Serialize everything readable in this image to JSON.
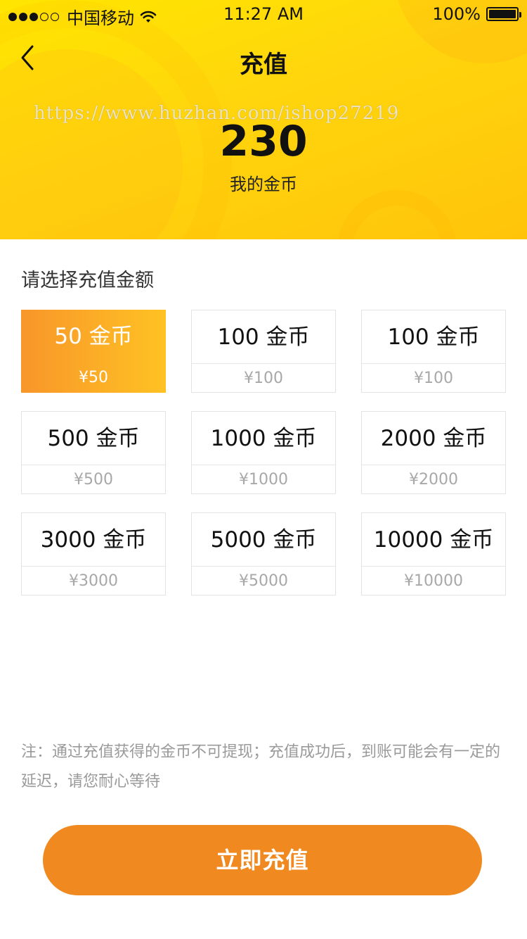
{
  "status_bar": {
    "carrier": "中国移动",
    "time": "11:27 AM",
    "battery": "100%",
    "signal_bars": 3,
    "signal_total": 5
  },
  "nav": {
    "title": "充值",
    "back_icon": "chevron-left-icon"
  },
  "watermark": "https://www.huzhan.com/ishop27219",
  "balance": {
    "value": "230",
    "label": "我的金币"
  },
  "section_title": "请选择充值金额",
  "options": [
    {
      "amount": "50 金币",
      "price": "¥50",
      "selected": true
    },
    {
      "amount": "100 金币",
      "price": "¥100",
      "selected": false
    },
    {
      "amount": "100 金币",
      "price": "¥100",
      "selected": false
    },
    {
      "amount": "500 金币",
      "price": "¥500",
      "selected": false
    },
    {
      "amount": "1000 金币",
      "price": "¥1000",
      "selected": false
    },
    {
      "amount": "2000 金币",
      "price": "¥2000",
      "selected": false
    },
    {
      "amount": "3000 金币",
      "price": "¥3000",
      "selected": false
    },
    {
      "amount": "5000 金币",
      "price": "¥5000",
      "selected": false
    },
    {
      "amount": "10000 金币",
      "price": "¥10000",
      "selected": false
    }
  ],
  "note": "注：通过充值获得的金币不可提现；充值成功后，到账可能会有一定的延迟，请您耐心等待",
  "cta_label": "立即充值",
  "colors": {
    "header_yellow": "#ffd50d",
    "accent_orange": "#f08a20",
    "selected_gradient_start": "#f8962a",
    "selected_gradient_end": "#ffc223"
  }
}
